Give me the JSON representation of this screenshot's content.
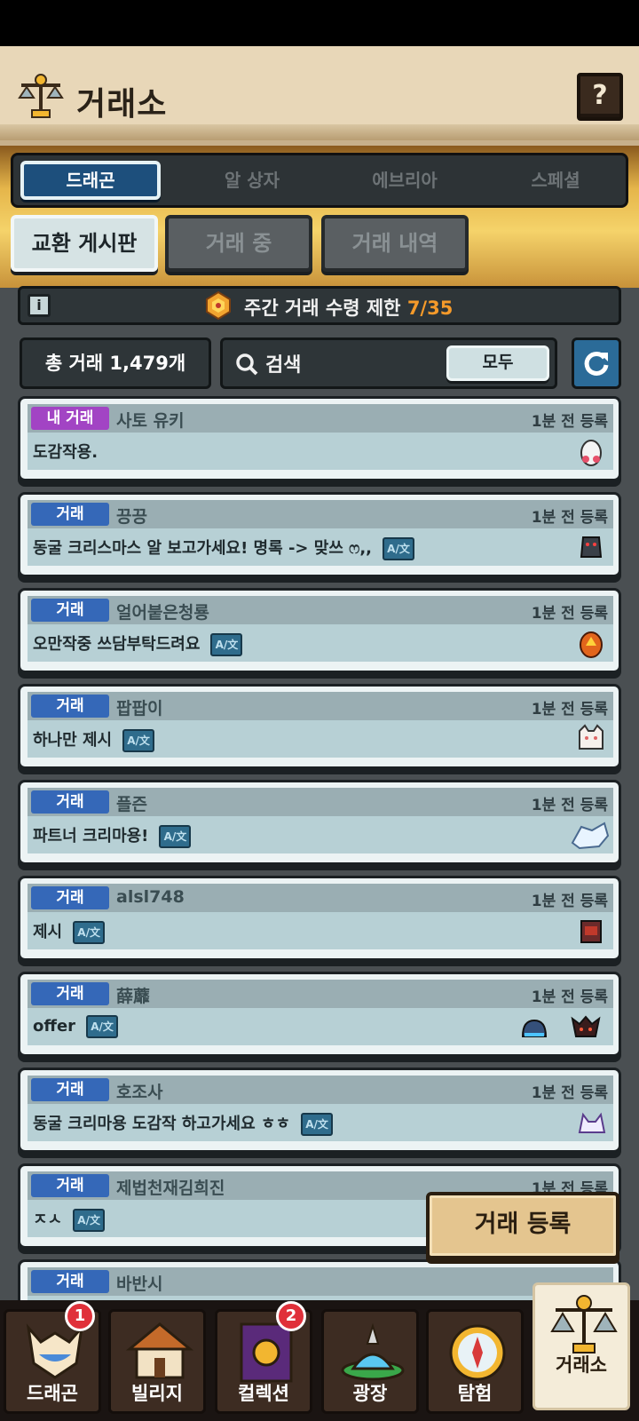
{
  "header": {
    "title": "거래소",
    "help_label": "?"
  },
  "tabs": [
    {
      "label": "드래곤",
      "active": true
    },
    {
      "label": "알 상자",
      "active": false
    },
    {
      "label": "에브리아",
      "active": false
    },
    {
      "label": "스페셜",
      "active": false
    }
  ],
  "subtabs": [
    {
      "label": "교환 게시판",
      "active": true
    },
    {
      "label": "거래 중",
      "active": false
    },
    {
      "label": "거래 내역",
      "active": false
    }
  ],
  "limit": {
    "info_label": "i",
    "text": "주간 거래 수령 제한",
    "value": "7/35"
  },
  "toolbar": {
    "count_label": "총 거래 1,479개",
    "search_placeholder": "검색",
    "filter_label": "모두"
  },
  "trades": [
    {
      "tag": "내 거래",
      "tag_type": "mine",
      "seller": "사토 유키",
      "time": "1분 전 등록",
      "message": "도감작용.",
      "translate": false,
      "icons": [
        "egg-icon"
      ]
    },
    {
      "tag": "거래",
      "tag_type": "trade",
      "seller": "끙끙",
      "time": "1분 전 등록",
      "message": "동굴 크리스마스 알 보고가세요! 명록 -> 맞쓰 ෆ,,",
      "translate": true,
      "icons": [
        "dark-dragon-icon"
      ]
    },
    {
      "tag": "거래",
      "tag_type": "trade",
      "seller": "얼어붙은청룡",
      "time": "1분 전 등록",
      "message": "오만작중 쓰담부탁드려요",
      "translate": true,
      "icons": [
        "fire-egg-icon"
      ]
    },
    {
      "tag": "거래",
      "tag_type": "trade",
      "seller": "팝팝이",
      "time": "1분 전 등록",
      "message": "하나만 제시",
      "translate": true,
      "icons": [
        "white-cat-icon"
      ]
    },
    {
      "tag": "거래",
      "tag_type": "trade",
      "seller": "플즌",
      "time": "1분 전 등록",
      "message": "파트너 크리마용!",
      "translate": true,
      "icons": [
        "ice-dragon-icon"
      ]
    },
    {
      "tag": "거래",
      "tag_type": "trade",
      "seller": "alsl748",
      "time": "1분 전 등록",
      "message": "제시",
      "translate": true,
      "icons": [
        "red-box-icon"
      ]
    },
    {
      "tag": "거래",
      "tag_type": "trade",
      "seller": "薛蘼",
      "time": "1분 전 등록",
      "message": "offer",
      "translate": true,
      "icons": [
        "blue-slime-icon",
        "dark-red-dragon-icon"
      ]
    },
    {
      "tag": "거래",
      "tag_type": "trade",
      "seller": "호조사",
      "time": "1분 전 등록",
      "message": "동굴 크리마용 도감작 하고가세요 ㅎㅎ",
      "translate": true,
      "icons": [
        "purple-fox-icon"
      ]
    },
    {
      "tag": "거래",
      "tag_type": "trade",
      "seller": "제법천재김희진",
      "time": "1분 전 등록",
      "message": "ㅈㅅ",
      "translate": true,
      "icons": []
    },
    {
      "tag": "거래",
      "tag_type": "trade",
      "seller": "바반시",
      "time": "",
      "message": "",
      "translate": false,
      "icons": []
    }
  ],
  "register_button": "거래 등록",
  "translate_label": "A/文",
  "nav": [
    {
      "label": "드래곤",
      "badge": "1",
      "icon": "dragon-icon"
    },
    {
      "label": "빌리지",
      "badge": "",
      "icon": "house-icon"
    },
    {
      "label": "컬렉션",
      "badge": "2",
      "icon": "book-icon"
    },
    {
      "label": "광장",
      "badge": "",
      "icon": "fountain-icon"
    },
    {
      "label": "탐험",
      "badge": "",
      "icon": "compass-icon"
    },
    {
      "label": "거래소",
      "badge": "",
      "icon": "scale-icon",
      "active": true
    }
  ]
}
